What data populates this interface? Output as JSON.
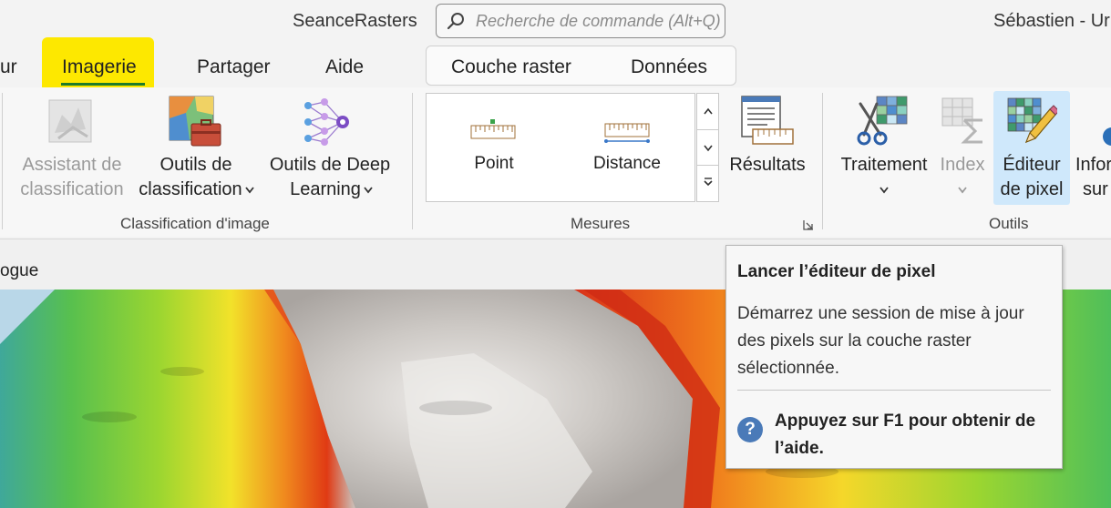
{
  "titlebar": {
    "app_title": "SeanceRasters",
    "search_placeholder": "Recherche de commande (Alt+Q)",
    "user": "Sébastien - Ur"
  },
  "tabs": {
    "partial_left": "ur",
    "imagerie": "Imagerie",
    "partager": "Partager",
    "aide": "Aide"
  },
  "contextual_tabs": {
    "couche_raster": "Couche raster",
    "donnees": "Données"
  },
  "ribbon": {
    "classification": {
      "group_label": "Classification d'image",
      "assistant": [
        "Assistant de",
        "classification"
      ],
      "outils": [
        "Outils de",
        "classification"
      ],
      "deep": [
        "Outils de Deep",
        "Learning"
      ]
    },
    "mesures": {
      "group_label": "Mesures",
      "point": "Point",
      "distance": "Distance",
      "resultats": "Résultats"
    },
    "outils": {
      "group_label": "Outils",
      "traitement": "Traitement",
      "index": "Index",
      "editeur": [
        "Éditeur",
        "de pixel"
      ],
      "info": [
        "Infor",
        "sur"
      ]
    }
  },
  "statusbar": {
    "partial_text": "ogue"
  },
  "tooltip": {
    "title": "Lancer l’éditeur de pixel",
    "body": "Démarrez une session de mise à jour des pixels sur la couche raster sélectionnée.",
    "help": "Appuyez sur F1 pour obtenir de l’aide.",
    "help_glyph": "?"
  },
  "icons": {
    "search": "search-icon",
    "dropdown": "chevron-down-icon",
    "help": "help-icon"
  },
  "colors": {
    "highlight": "#fde800",
    "tab_underline": "#1e7b2a",
    "selected_button": "#cfe8fb"
  }
}
